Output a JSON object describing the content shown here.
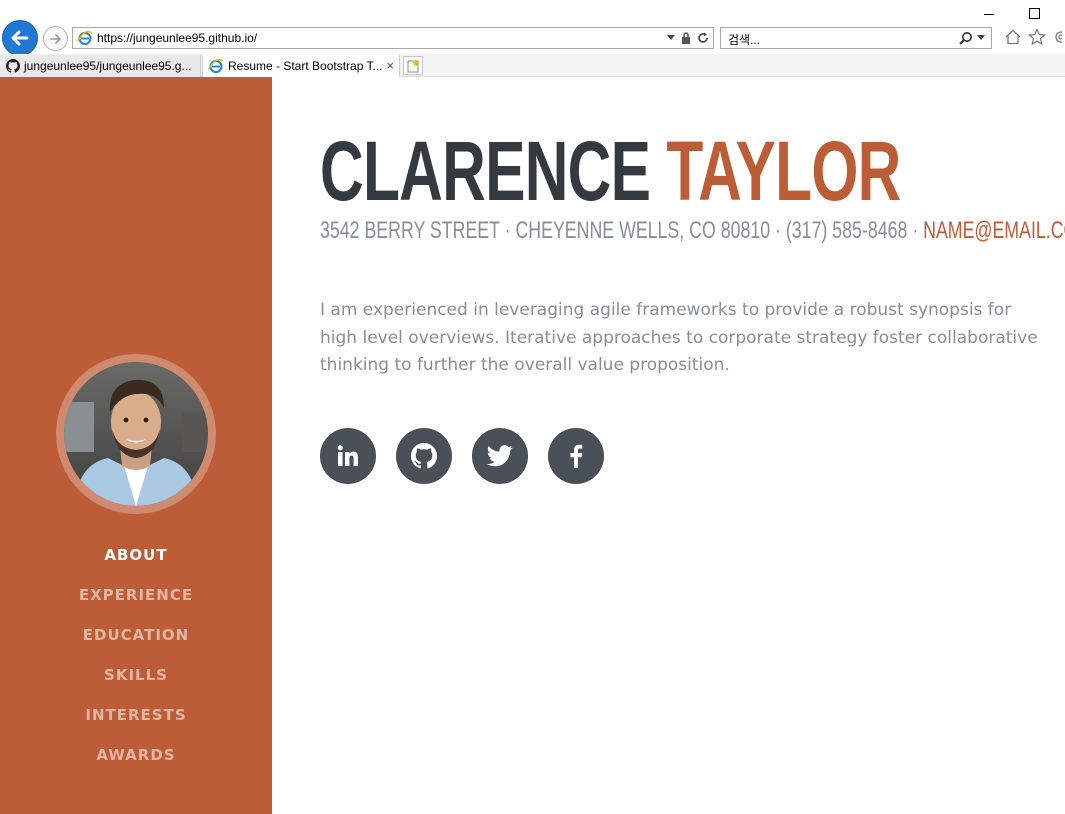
{
  "browser": {
    "url": "https://jungeunlee95.github.io/",
    "search_placeholder": "검색...",
    "tabs": [
      {
        "label": "jungeunlee95/jungeunlee95.g...",
        "icon": "github-icon",
        "active": false
      },
      {
        "label": "Resume - Start Bootstrap T...",
        "icon": "ie-icon",
        "active": true
      }
    ],
    "tab_close": "×"
  },
  "sidebar": {
    "nav": [
      {
        "label": "ABOUT",
        "active": true
      },
      {
        "label": "EXPERIENCE",
        "active": false
      },
      {
        "label": "EDUCATION",
        "active": false
      },
      {
        "label": "SKILLS",
        "active": false
      },
      {
        "label": "INTERESTS",
        "active": false
      },
      {
        "label": "AWARDS",
        "active": false
      }
    ]
  },
  "about": {
    "first_name": "CLARENCE",
    "last_name": "TAYLOR",
    "contact": "3542 BERRY STREET · CHEYENNE WELLS, CO 80810 · (317) 585-8468 · ",
    "email": "NAME@EMAIL.COM",
    "bio": "I am experienced in leveraging agile frameworks to provide a robust synopsis for high level overviews. Iterative approaches to corporate strategy foster collaborative thinking to further the overall value proposition.",
    "socials": [
      "linkedin-icon",
      "github-icon",
      "twitter-icon",
      "facebook-icon"
    ]
  },
  "colors": {
    "accent": "#bd5d38",
    "dark": "#343a40",
    "muted": "#868e96",
    "social_bg": "#495057"
  }
}
